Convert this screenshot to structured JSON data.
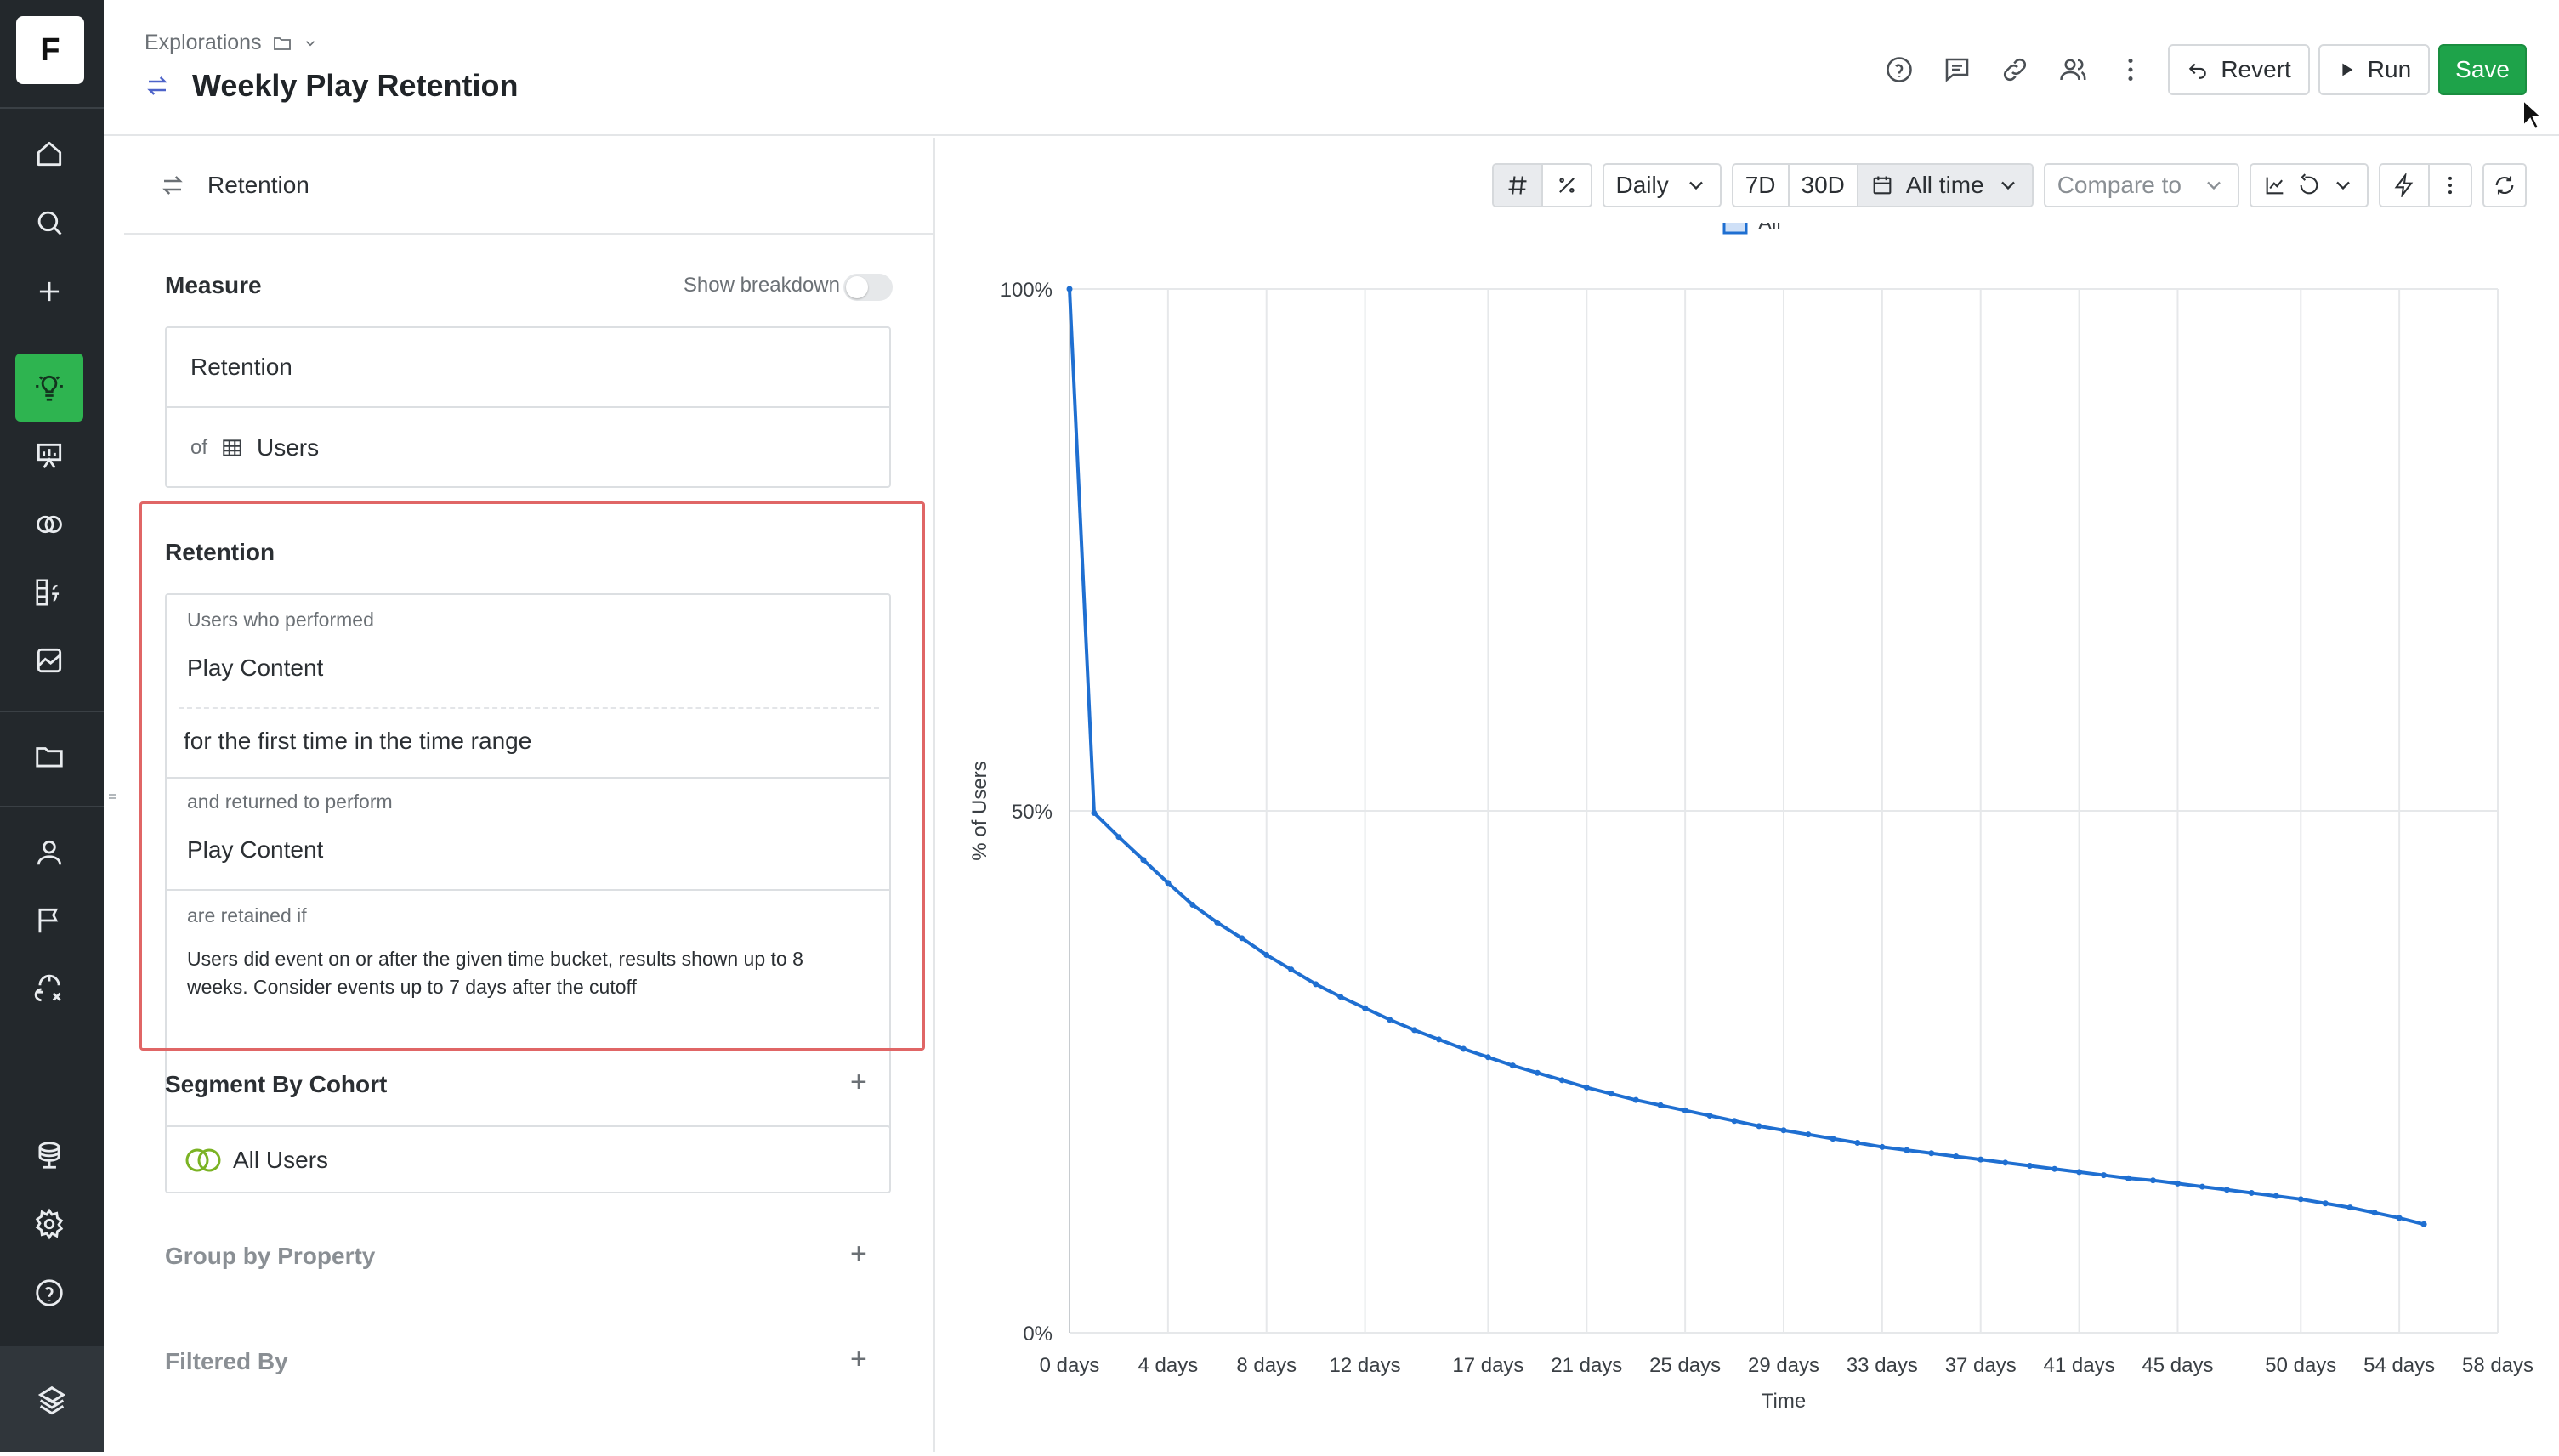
{
  "app": {
    "logo_letter": "F"
  },
  "sidebar": {
    "items": [
      {
        "icon": "home-icon"
      },
      {
        "icon": "search-icon"
      },
      {
        "icon": "plus-icon"
      },
      {
        "icon": "lightbulb-icon",
        "active": true
      },
      {
        "icon": "presentation-icon"
      },
      {
        "icon": "cohorts-icon"
      },
      {
        "icon": "formula-icon"
      },
      {
        "icon": "chart-image-icon"
      },
      {
        "icon": "folder-icon"
      },
      {
        "icon": "user-icon"
      },
      {
        "icon": "flag-icon"
      },
      {
        "icon": "experiment-icon"
      },
      {
        "icon": "database-icon"
      },
      {
        "icon": "settings-icon"
      },
      {
        "icon": "help-icon"
      }
    ]
  },
  "header": {
    "breadcrumb": "Explorations",
    "title": "Weekly Play Retention",
    "revert_label": "Revert",
    "run_label": "Run",
    "save_label": "Save"
  },
  "left_panel": {
    "type_label": "Retention",
    "measure": {
      "label": "Measure",
      "show_breakdown_label": "Show breakdown",
      "metric": "Retention",
      "of_label": "of",
      "entity": "Users"
    },
    "retention": {
      "label": "Retention",
      "performed_label": "Users who performed",
      "performed_event": "Play Content",
      "first_time_text": "for the first time in the time range",
      "returned_label": "and returned to perform",
      "returned_event": "Play Content",
      "retained_label": "are retained if",
      "retained_desc_line1": "Users did event on or after the given time bucket, results shown up to 8",
      "retained_desc_line2": "weeks. Consider events up to 7 days after the cutoff"
    },
    "segment": {
      "label": "Segment By Cohort",
      "value": "All Users"
    },
    "group_by_label": "Group by Property",
    "filtered_by_label": "Filtered By"
  },
  "toolbar": {
    "granularity": "Daily",
    "range_7d": "7D",
    "range_30d": "30D",
    "range_all": "All time",
    "compare_placeholder": "Compare to"
  },
  "chart_data": {
    "type": "line",
    "legend": [
      "All"
    ],
    "legend_position": "top-center",
    "ylabel": "% of Users",
    "xlabel": "Time",
    "y_ticks": [
      "100%",
      "50%",
      "0%"
    ],
    "ylim": [
      0,
      100
    ],
    "x_ticks": [
      "0 days",
      "4 days",
      "8 days",
      "12 days",
      "17 days",
      "21 days",
      "25 days",
      "29 days",
      "33 days",
      "37 days",
      "41 days",
      "45 days",
      "50 days",
      "54 days",
      "58 days"
    ],
    "x_tick_values": [
      0,
      4,
      8,
      12,
      17,
      21,
      25,
      29,
      33,
      37,
      41,
      45,
      50,
      54,
      58
    ],
    "xlim": [
      0,
      56
    ],
    "line_color": "#1f6fd1",
    "series": [
      {
        "name": "All",
        "x": [
          0,
          1,
          2,
          3,
          4,
          5,
          6,
          7,
          8,
          9,
          10,
          11,
          12,
          13,
          14,
          15,
          16,
          17,
          18,
          19,
          20,
          21,
          22,
          23,
          24,
          25,
          26,
          27,
          28,
          29,
          30,
          31,
          32,
          33,
          34,
          35,
          36,
          37,
          38,
          39,
          40,
          41,
          42,
          43,
          44,
          45,
          46,
          47,
          48,
          49,
          50,
          51,
          52,
          53,
          54,
          55
        ],
        "values": [
          100.0,
          49.8,
          47.5,
          45.3,
          43.1,
          41.0,
          39.3,
          37.8,
          36.2,
          34.8,
          33.4,
          32.2,
          31.1,
          30.0,
          29.0,
          28.1,
          27.2,
          26.4,
          25.6,
          24.9,
          24.2,
          23.5,
          22.9,
          22.3,
          21.8,
          21.3,
          20.8,
          20.3,
          19.8,
          19.4,
          19.0,
          18.6,
          18.2,
          17.8,
          17.5,
          17.2,
          16.9,
          16.6,
          16.3,
          16.0,
          15.7,
          15.4,
          15.1,
          14.8,
          14.6,
          14.3,
          14.0,
          13.7,
          13.4,
          13.1,
          12.8,
          12.4,
          12.0,
          11.5,
          11.0,
          10.4
        ]
      }
    ]
  }
}
